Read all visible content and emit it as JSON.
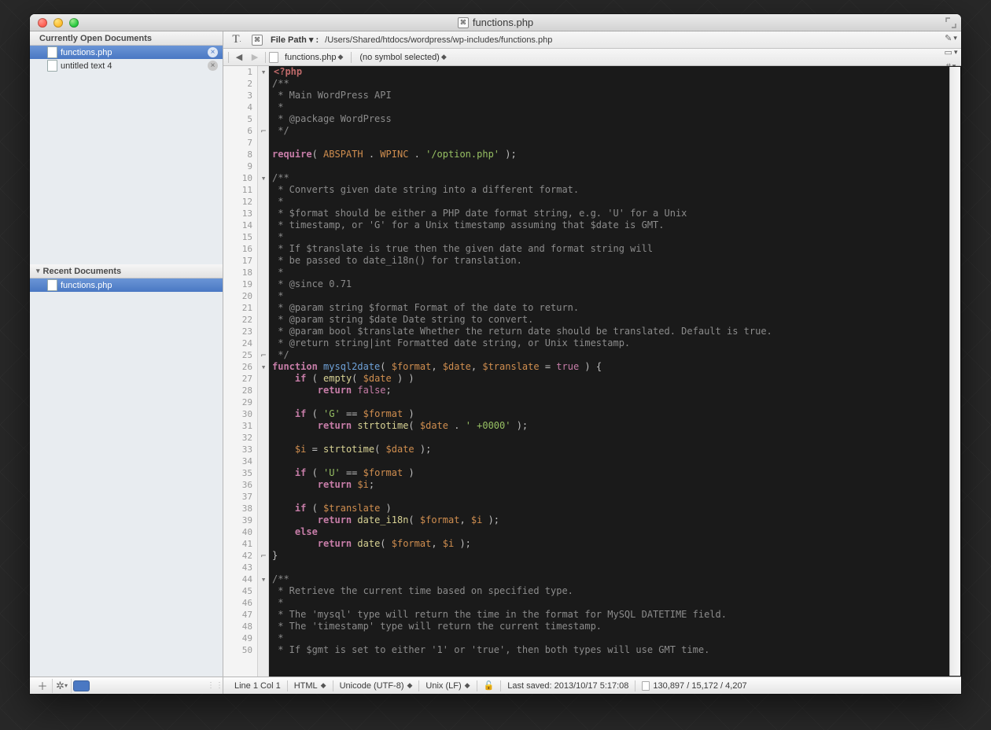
{
  "window": {
    "title": "functions.php"
  },
  "sidebar": {
    "open_header": "Currently Open Documents",
    "recent_header": "Recent Documents",
    "open_docs": [
      {
        "name": "functions.php",
        "selected": true
      },
      {
        "name": "untitled text 4",
        "selected": false
      }
    ],
    "recent_docs": [
      {
        "name": "functions.php",
        "selected": true
      }
    ]
  },
  "pathbar": {
    "label": "File Path ▾ :",
    "path": "/Users/Shared/htdocs/wordpress/wp-includes/functions.php"
  },
  "navbar": {
    "filename": "functions.php",
    "symbol": "(no symbol selected)"
  },
  "gutter_fold_marks": {
    "1": "▾",
    "6": "⌐",
    "10": "▾",
    "25": "⌐",
    "26": "▾",
    "42": "⌐",
    "44": "▾"
  },
  "code_lines": [
    [
      [
        "hl",
        ""
      ],
      [
        "c-php-tag",
        "<?php"
      ]
    ],
    [
      [
        "c-comment",
        "/**"
      ]
    ],
    [
      [
        "c-comment",
        " * Main WordPress API"
      ]
    ],
    [
      [
        "c-comment",
        " *"
      ]
    ],
    [
      [
        "c-comment",
        " * @package WordPress"
      ]
    ],
    [
      [
        "c-comment",
        " */"
      ]
    ],
    [
      [
        "",
        ""
      ]
    ],
    [
      [
        "c-keyword",
        "require"
      ],
      [
        "c-punc",
        "( "
      ],
      [
        "c-const",
        "ABSPATH"
      ],
      [
        "c-punc",
        " . "
      ],
      [
        "c-const",
        "WPINC"
      ],
      [
        "c-punc",
        " . "
      ],
      [
        "c-string",
        "'/option.php'"
      ],
      [
        "c-punc",
        " );"
      ]
    ],
    [
      [
        "",
        ""
      ]
    ],
    [
      [
        "c-comment",
        "/**"
      ]
    ],
    [
      [
        "c-comment",
        " * Converts given date string into a different format."
      ]
    ],
    [
      [
        "c-comment",
        " *"
      ]
    ],
    [
      [
        "c-comment",
        " * $format should be either a PHP date format string, e.g. 'U' for a Unix"
      ]
    ],
    [
      [
        "c-comment",
        " * timestamp, or 'G' for a Unix timestamp assuming that $date is GMT."
      ]
    ],
    [
      [
        "c-comment",
        " *"
      ]
    ],
    [
      [
        "c-comment",
        " * If $translate is true then the given date and format string will"
      ]
    ],
    [
      [
        "c-comment",
        " * be passed to date_i18n() for translation."
      ]
    ],
    [
      [
        "c-comment",
        " *"
      ]
    ],
    [
      [
        "c-comment",
        " * @since 0.71"
      ]
    ],
    [
      [
        "c-comment",
        " *"
      ]
    ],
    [
      [
        "c-comment",
        " * @param string $format Format of the date to return."
      ]
    ],
    [
      [
        "c-comment",
        " * @param string $date Date string to convert."
      ]
    ],
    [
      [
        "c-comment",
        " * @param bool $translate Whether the return date should be translated. Default is true."
      ]
    ],
    [
      [
        "c-comment",
        " * @return string|int Formatted date string, or Unix timestamp."
      ]
    ],
    [
      [
        "c-comment",
        " */"
      ]
    ],
    [
      [
        "c-keyword",
        "function"
      ],
      [
        "",
        " "
      ],
      [
        "c-func-def",
        "mysql2date"
      ],
      [
        "c-punc",
        "( "
      ],
      [
        "c-var",
        "$format"
      ],
      [
        "c-punc",
        ", "
      ],
      [
        "c-var",
        "$date"
      ],
      [
        "c-punc",
        ", "
      ],
      [
        "c-var",
        "$translate"
      ],
      [
        "c-punc",
        " = "
      ],
      [
        "c-bool",
        "true"
      ],
      [
        "c-punc",
        " ) {"
      ]
    ],
    [
      [
        "",
        "    "
      ],
      [
        "c-keyword",
        "if"
      ],
      [
        "c-punc",
        " ( "
      ],
      [
        "c-call",
        "empty"
      ],
      [
        "c-punc",
        "( "
      ],
      [
        "c-var",
        "$date"
      ],
      [
        "c-punc",
        " ) )"
      ]
    ],
    [
      [
        "",
        "        "
      ],
      [
        "c-keyword",
        "return"
      ],
      [
        "",
        " "
      ],
      [
        "c-bool",
        "false"
      ],
      [
        "c-punc",
        ";"
      ]
    ],
    [
      [
        "",
        ""
      ]
    ],
    [
      [
        "",
        "    "
      ],
      [
        "c-keyword",
        "if"
      ],
      [
        "c-punc",
        " ( "
      ],
      [
        "c-string",
        "'G'"
      ],
      [
        "c-punc",
        " == "
      ],
      [
        "c-var",
        "$format"
      ],
      [
        "c-punc",
        " )"
      ]
    ],
    [
      [
        "",
        "        "
      ],
      [
        "c-keyword",
        "return"
      ],
      [
        "",
        " "
      ],
      [
        "c-call",
        "strtotime"
      ],
      [
        "c-punc",
        "( "
      ],
      [
        "c-var",
        "$date"
      ],
      [
        "c-punc",
        " . "
      ],
      [
        "c-string",
        "' +0000'"
      ],
      [
        "c-punc",
        " );"
      ]
    ],
    [
      [
        "",
        ""
      ]
    ],
    [
      [
        "",
        "    "
      ],
      [
        "c-var",
        "$i"
      ],
      [
        "c-punc",
        " = "
      ],
      [
        "c-call",
        "strtotime"
      ],
      [
        "c-punc",
        "( "
      ],
      [
        "c-var",
        "$date"
      ],
      [
        "c-punc",
        " );"
      ]
    ],
    [
      [
        "",
        ""
      ]
    ],
    [
      [
        "",
        "    "
      ],
      [
        "c-keyword",
        "if"
      ],
      [
        "c-punc",
        " ( "
      ],
      [
        "c-string",
        "'U'"
      ],
      [
        "c-punc",
        " == "
      ],
      [
        "c-var",
        "$format"
      ],
      [
        "c-punc",
        " )"
      ]
    ],
    [
      [
        "",
        "        "
      ],
      [
        "c-keyword",
        "return"
      ],
      [
        "",
        " "
      ],
      [
        "c-var",
        "$i"
      ],
      [
        "c-punc",
        ";"
      ]
    ],
    [
      [
        "",
        ""
      ]
    ],
    [
      [
        "",
        "    "
      ],
      [
        "c-keyword",
        "if"
      ],
      [
        "c-punc",
        " ( "
      ],
      [
        "c-var",
        "$translate"
      ],
      [
        "c-punc",
        " )"
      ]
    ],
    [
      [
        "",
        "        "
      ],
      [
        "c-keyword",
        "return"
      ],
      [
        "",
        " "
      ],
      [
        "c-call",
        "date_i18n"
      ],
      [
        "c-punc",
        "( "
      ],
      [
        "c-var",
        "$format"
      ],
      [
        "c-punc",
        ", "
      ],
      [
        "c-var",
        "$i"
      ],
      [
        "c-punc",
        " );"
      ]
    ],
    [
      [
        "",
        "    "
      ],
      [
        "c-keyword",
        "else"
      ]
    ],
    [
      [
        "",
        "        "
      ],
      [
        "c-keyword",
        "return"
      ],
      [
        "",
        " "
      ],
      [
        "c-call",
        "date"
      ],
      [
        "c-punc",
        "( "
      ],
      [
        "c-var",
        "$format"
      ],
      [
        "c-punc",
        ", "
      ],
      [
        "c-var",
        "$i"
      ],
      [
        "c-punc",
        " );"
      ]
    ],
    [
      [
        "c-punc",
        "}"
      ]
    ],
    [
      [
        "",
        ""
      ]
    ],
    [
      [
        "c-comment",
        "/**"
      ]
    ],
    [
      [
        "c-comment",
        " * Retrieve the current time based on specified type."
      ]
    ],
    [
      [
        "c-comment",
        " *"
      ]
    ],
    [
      [
        "c-comment",
        " * The 'mysql' type will return the time in the format for MySQL DATETIME field."
      ]
    ],
    [
      [
        "c-comment",
        " * The 'timestamp' type will return the current timestamp."
      ]
    ],
    [
      [
        "c-comment",
        " *"
      ]
    ],
    [
      [
        "c-comment",
        " * If $gmt is set to either '1' or 'true', then both types will use GMT time."
      ]
    ]
  ],
  "status": {
    "cursor": "Line 1 Col 1",
    "language": "HTML",
    "encoding": "Unicode (UTF-8)",
    "line_endings": "Unix (LF)",
    "saved": "Last saved: 2013/10/17 5:17:08",
    "counts": "130,897 / 15,172 / 4,207"
  }
}
